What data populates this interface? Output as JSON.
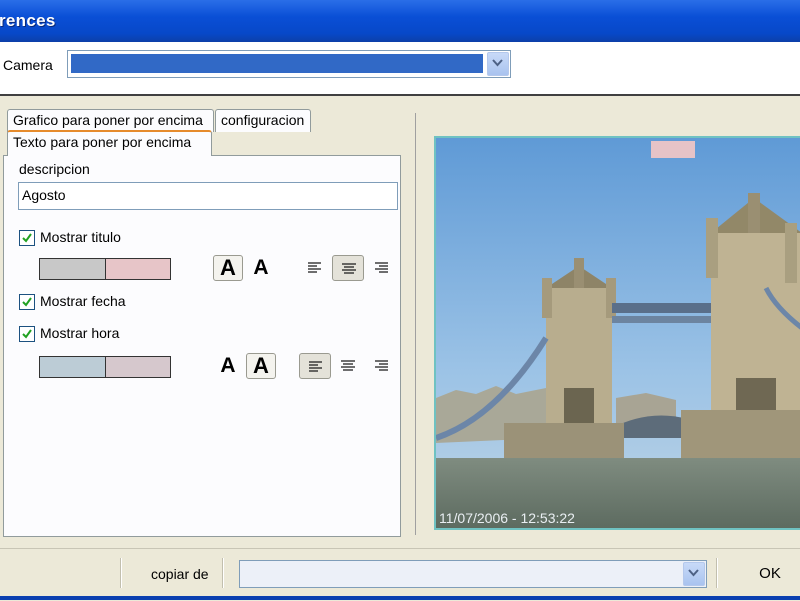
{
  "window": {
    "title": "rences"
  },
  "camera": {
    "label": "Camera",
    "selected": ""
  },
  "tabs": [
    {
      "label": "Grafico para poner por encima"
    },
    {
      "label": "configuracion"
    },
    {
      "label": "Texto para poner por encima",
      "active": true
    }
  ],
  "text_panel": {
    "description_label": "descripcion",
    "description_value": "Agosto",
    "show_title": {
      "label": "Mostrar titulo",
      "checked": true,
      "color_bg": "#c8c8c8",
      "color_fg": "#e7c5c8",
      "bold_glyph": "A",
      "normal_glyph": "A",
      "align": "center"
    },
    "show_date": {
      "label": "Mostrar fecha",
      "checked": true
    },
    "show_time": {
      "label": "Mostrar hora",
      "checked": true,
      "color_bg": "#bcccd6",
      "color_fg": "#d6c8cd",
      "bold_glyph": "A",
      "normal_glyph": "A",
      "align": "left"
    }
  },
  "preview": {
    "datetime": "11/07/2006 - 12:53:22"
  },
  "bottom": {
    "copy_label": "copiar de",
    "copy_selected": "",
    "ok_label": "OK"
  },
  "colors": {
    "titlebar": "#0a4fd6",
    "selection": "#3169c6",
    "tab_accent": "#e68b2c"
  }
}
